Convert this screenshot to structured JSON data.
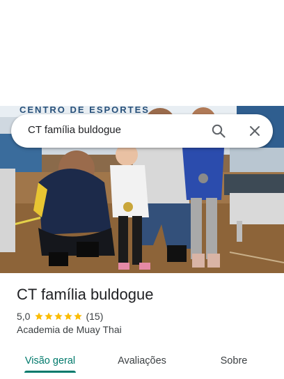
{
  "search": {
    "query": "CT família buldogue"
  },
  "photo": {
    "banner_text": "CENTRO DE ESPORTES"
  },
  "place": {
    "name": "CT família buldogue",
    "rating": "5,0",
    "stars": 5,
    "review_count": "(15)",
    "category": "Academia de Muay Thai"
  },
  "tabs": [
    {
      "label": "Visão geral",
      "active": true
    },
    {
      "label": "Avaliações",
      "active": false
    },
    {
      "label": "Sobre",
      "active": false
    }
  ],
  "colors": {
    "accent": "#00796b",
    "star": "#fbbc04",
    "text": "#202124",
    "secondary_text": "#3c4043"
  }
}
